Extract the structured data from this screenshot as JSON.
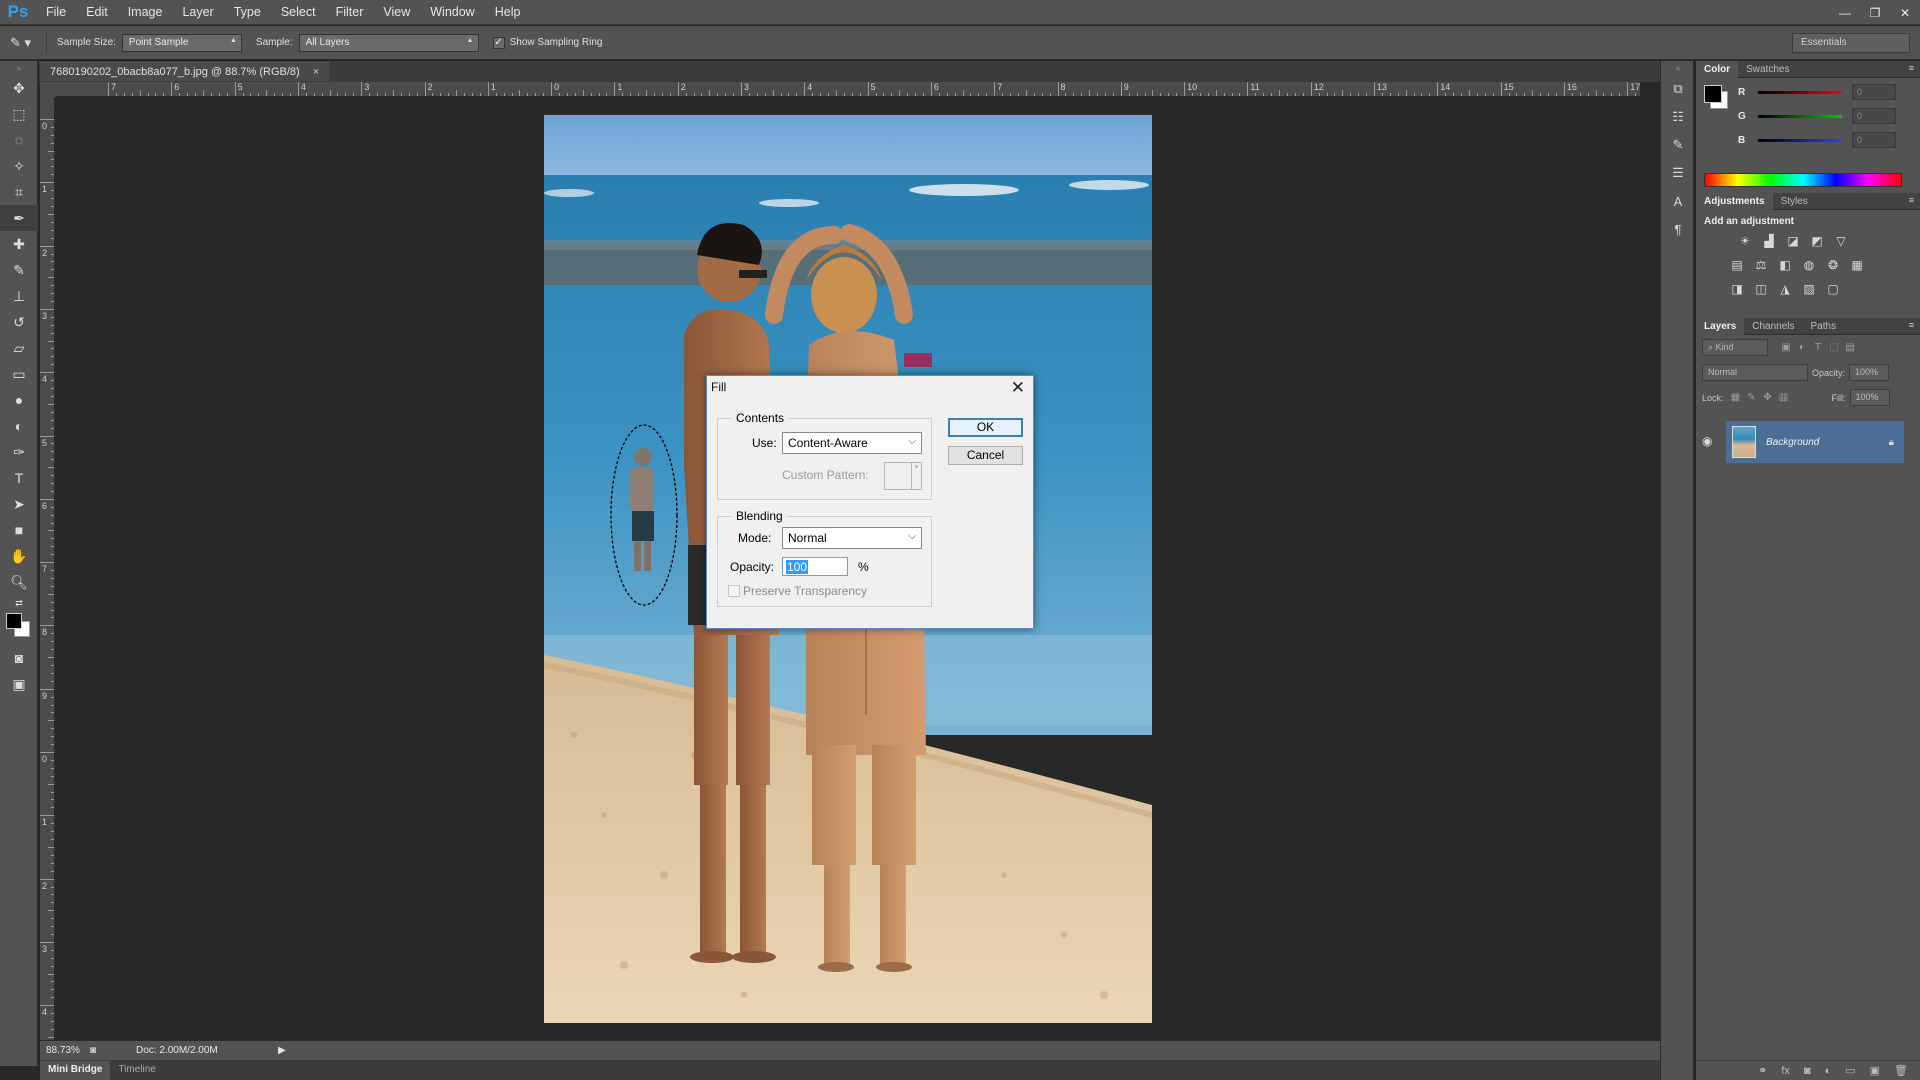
{
  "app": {
    "logo": "Ps",
    "menus": [
      "File",
      "Edit",
      "Image",
      "Layer",
      "Type",
      "Select",
      "Filter",
      "View",
      "Window",
      "Help"
    ],
    "window_controls": [
      "—",
      "❐",
      "✕"
    ]
  },
  "options_bar": {
    "sample_size_label": "Sample Size:",
    "sample_size_value": "Point Sample",
    "sample_label": "Sample:",
    "sample_value": "All Layers",
    "show_ring_label": "Show Sampling Ring",
    "show_ring_checked": true,
    "workspace": "Essentials"
  },
  "document": {
    "tab_title": "7680190202_0bacb8a077_b.jpg @ 88.7% (RGB/8)",
    "close_glyph": "×"
  },
  "rulers": {
    "h_labels": [
      "7",
      "6",
      "5",
      "4",
      "3",
      "2",
      "1",
      "0",
      "1",
      "2",
      "3",
      "4",
      "5",
      "6",
      "7",
      "8",
      "9",
      "10",
      "11",
      "12",
      "13",
      "14",
      "15",
      "16",
      "17"
    ],
    "v_labels": [
      "0",
      "1",
      "2",
      "3",
      "4",
      "5",
      "6",
      "7",
      "8",
      "9",
      "0",
      "1",
      "2",
      "3",
      "4"
    ]
  },
  "status": {
    "zoom": "88.73%",
    "doc_info": "Doc: 2.00M/2.00M",
    "arrow": "▶"
  },
  "bottom_tabs": [
    "Mini Bridge",
    "Timeline"
  ],
  "panels": {
    "color_tabs": [
      "Color",
      "Swatches"
    ],
    "color_channels": [
      {
        "label": "R",
        "value": "0",
        "color": "#e02020"
      },
      {
        "label": "G",
        "value": "0",
        "color": "#20c020"
      },
      {
        "label": "B",
        "value": "0",
        "color": "#2040e0"
      }
    ],
    "adjust_tabs": [
      "Adjustments",
      "Styles"
    ],
    "adjust_title": "Add an adjustment",
    "layers_tabs": [
      "Layers",
      "Channels",
      "Paths"
    ],
    "kind_label": "Kind",
    "blend_mode": "Normal",
    "opacity_label": "Opacity:",
    "opacity_value": "100%",
    "lock_label": "Lock:",
    "fill_label": "Fill:",
    "fill_value": "100%",
    "layer_name": "Background"
  },
  "fill_dialog": {
    "title": "Fill",
    "close": "✕",
    "contents_group": "Contents",
    "use_label": "Use:",
    "use_value": "Content-Aware",
    "custom_pattern_label": "Custom Pattern:",
    "blending_group": "Blending",
    "mode_label": "Mode:",
    "mode_value": "Normal",
    "opacity_label": "Opacity:",
    "opacity_value": "100",
    "percent": "%",
    "preserve_label": "Preserve Transparency",
    "ok": "OK",
    "cancel": "Cancel"
  }
}
